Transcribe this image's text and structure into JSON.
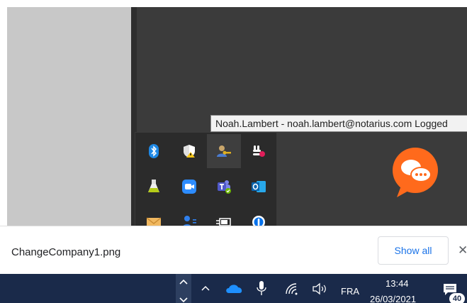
{
  "tooltip": {
    "text": "Noah.Lambert - noah.lambert@notarius.com Logged"
  },
  "tray": {
    "icons": [
      "bluetooth-icon",
      "windows-security-icon",
      "credential-manager-icon",
      "slack-icon",
      "flask-icon",
      "zoom-icon",
      "teams-icon",
      "outlook-icon",
      "mail-icon",
      "people-icon",
      "power-icon",
      "1password-icon",
      "creative-cloud-icon"
    ]
  },
  "download": {
    "filename": "ChangeCompany1.png",
    "show_all_label": "Show all",
    "close_glyph": "✕"
  },
  "taskbar": {
    "language": "FRA",
    "time": "13:44",
    "date": "26/03/2021",
    "notification_count": "40"
  }
}
